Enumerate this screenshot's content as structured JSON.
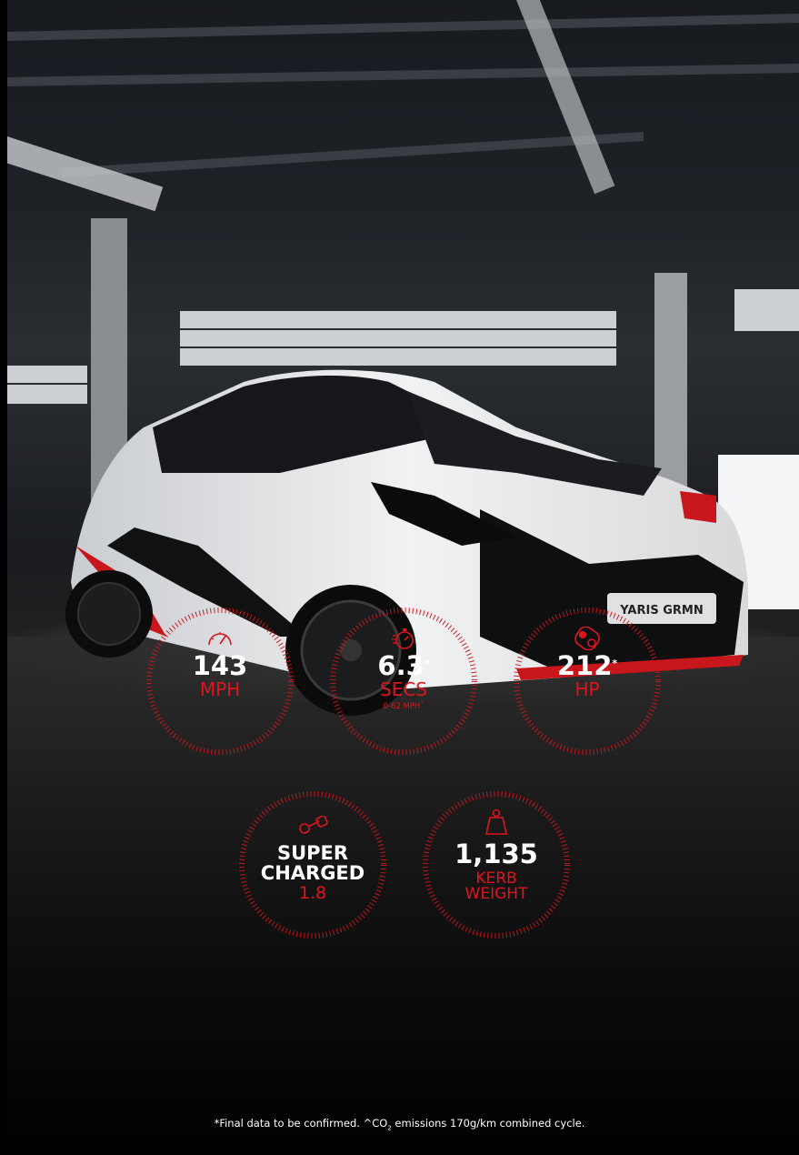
{
  "hero": {
    "plate_text": "YARIS GRMN"
  },
  "stats": {
    "speed": {
      "icon": "speedometer-icon",
      "value": "143",
      "unit": "MPH"
    },
    "accel": {
      "icon": "stopwatch-icon",
      "value": "6.3",
      "asterisk": "*",
      "unit": "SECS",
      "sub": "0-62 MPH",
      "sub_mark": "^"
    },
    "power": {
      "icon": "engine-belt-icon",
      "value": "212",
      "asterisk": "*",
      "unit": "HP"
    },
    "engine": {
      "icon": "piston-icon",
      "line1": "SUPER",
      "line2": "CHARGED",
      "unit": "1.8"
    },
    "weight": {
      "icon": "weight-icon",
      "value": "1,135",
      "unit_line1": "KERB",
      "unit_line2": "WEIGHT"
    }
  },
  "footnote": {
    "before": "*Final data to be confirmed. ^CO",
    "subscript": "2",
    "after": " emissions 170g/km combined cycle."
  },
  "colors": {
    "accent": "#e0141e",
    "text": "#ffffff",
    "background": "#000000"
  }
}
